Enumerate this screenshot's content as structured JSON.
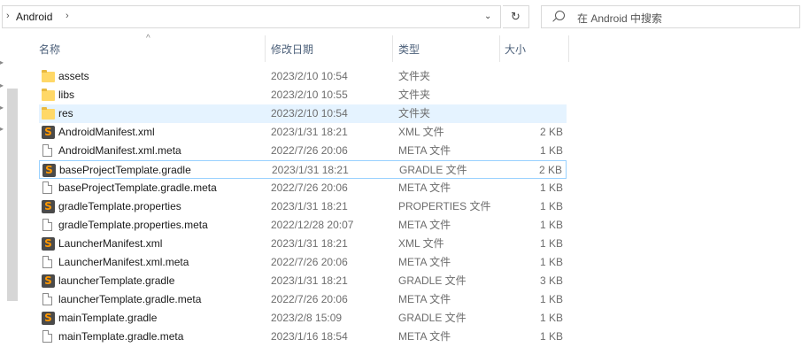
{
  "address": {
    "crumb": "Android",
    "search_placeholder": "在 Android 中搜索",
    "dropdown_glyph": "⌄",
    "refresh_glyph": "↻"
  },
  "columns": {
    "name": "名称",
    "date": "修改日期",
    "type": "类型",
    "size": "大小"
  },
  "files": [
    {
      "name": "assets",
      "date": "2023/2/10 10:54",
      "type": "文件夹",
      "size": "",
      "icon": "folder-icon"
    },
    {
      "name": "libs",
      "date": "2023/2/10 10:55",
      "type": "文件夹",
      "size": "",
      "icon": "folder-icon"
    },
    {
      "name": "res",
      "date": "2023/2/10 10:54",
      "type": "文件夹",
      "size": "",
      "icon": "folder-icon"
    },
    {
      "name": "AndroidManifest.xml",
      "date": "2023/1/31 18:21",
      "type": "XML 文件",
      "size": "2 KB",
      "icon": "sublime-icon"
    },
    {
      "name": "AndroidManifest.xml.meta",
      "date": "2022/7/26 20:06",
      "type": "META 文件",
      "size": "1 KB",
      "icon": "doc-icon"
    },
    {
      "name": "baseProjectTemplate.gradle",
      "date": "2023/1/31 18:21",
      "type": "GRADLE 文件",
      "size": "2 KB",
      "icon": "sublime-icon"
    },
    {
      "name": "baseProjectTemplate.gradle.meta",
      "date": "2022/7/26 20:06",
      "type": "META 文件",
      "size": "1 KB",
      "icon": "doc-icon"
    },
    {
      "name": "gradleTemplate.properties",
      "date": "2023/1/31 18:21",
      "type": "PROPERTIES 文件",
      "size": "1 KB",
      "icon": "sublime-icon"
    },
    {
      "name": "gradleTemplate.properties.meta",
      "date": "2022/12/28 20:07",
      "type": "META 文件",
      "size": "1 KB",
      "icon": "doc-icon"
    },
    {
      "name": "LauncherManifest.xml",
      "date": "2023/1/31 18:21",
      "type": "XML 文件",
      "size": "1 KB",
      "icon": "sublime-icon"
    },
    {
      "name": "LauncherManifest.xml.meta",
      "date": "2022/7/26 20:06",
      "type": "META 文件",
      "size": "1 KB",
      "icon": "doc-icon"
    },
    {
      "name": "launcherTemplate.gradle",
      "date": "2023/1/31 18:21",
      "type": "GRADLE 文件",
      "size": "3 KB",
      "icon": "sublime-icon"
    },
    {
      "name": "launcherTemplate.gradle.meta",
      "date": "2022/7/26 20:06",
      "type": "META 文件",
      "size": "1 KB",
      "icon": "doc-icon"
    },
    {
      "name": "mainTemplate.gradle",
      "date": "2023/2/8 15:09",
      "type": "GRADLE 文件",
      "size": "1 KB",
      "icon": "sublime-icon"
    },
    {
      "name": "mainTemplate.gradle.meta",
      "date": "2023/1/16 18:54",
      "type": "META 文件",
      "size": "1 KB",
      "icon": "doc-icon"
    }
  ],
  "state": {
    "hover_row": "res",
    "selected_row": "baseProjectTemplate.gradle"
  },
  "colors": {
    "hover": "#e5f3ff",
    "selected_border": "#99d1ff",
    "header_text": "#4c607a"
  }
}
